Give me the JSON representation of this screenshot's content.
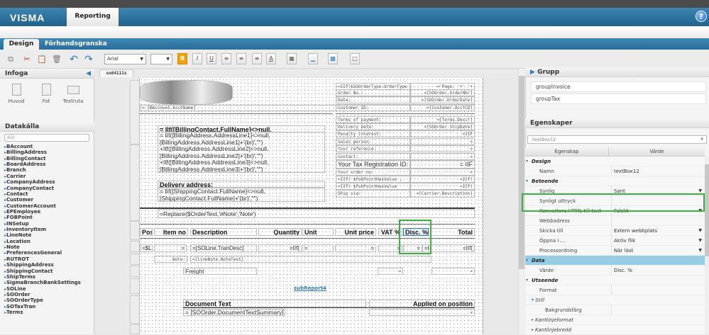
{
  "app": {
    "logo": "VISMA",
    "module_tab": "Reporting",
    "help_icon": "help-icon"
  },
  "tabs": [
    {
      "label": "Design",
      "active": true
    },
    {
      "label": "Förhandsgranska",
      "active": false
    }
  ],
  "toolbar": {
    "font": "Arial",
    "font_size": "",
    "bold": "B",
    "italic": "I",
    "underline": "U",
    "font_color": "A",
    "bold_active_color": "#f0a30a"
  },
  "left": {
    "insert_title": "Infoga",
    "insert_items": [
      "Huvud",
      "Fot",
      "Textruta"
    ],
    "datasource_title": "Datakälla",
    "search_placeholder": "Sök",
    "tree": [
      "BAccount",
      "BillingAddress",
      "BillingContact",
      "BoardAddress",
      "Branch",
      "Carrier",
      "CompanyAddress",
      "CompanyContact",
      "Contact",
      "Customer",
      "CustomerAccount",
      "EPEmployee",
      "FOBPoint",
      "INSetup",
      "InventoryItem",
      "LineNote",
      "Location",
      "Note",
      "PreferencesGeneral",
      "RUTROT",
      "ShippingAddress",
      "ShippingContact",
      "ShipTerms",
      "SigmaBranchBankSettings",
      "SOLine",
      "SOOrder",
      "SOOrderType",
      "SOTaxTran",
      "Terms"
    ]
  },
  "document_tab": "so64111s",
  "report": {
    "acct_name": "= [BAccount.AcctName]",
    "billing_title": "= IIf([BillingContact.FullName]<>null,",
    "billing_lines": [
      "= IIf([BillingAddress.AddressLine1]<>null,",
      "[BillingAddress.AddressLine1]+'{br}',\"\")",
      "+IIf([BillingAddress.AddressLine2]<>null,",
      "[BillingAddress.AddressLine2]+'{br}',\"\")",
      "+IIf([BillingAddress.AddressLine3]<>null,",
      "[BillingAddress.AddressLine3]+'{br}',\"\")"
    ],
    "delivery_title": "Delivery address:",
    "delivery_lines": [
      "= IIf([ShippingContact.FullName]<>null,",
      "[ShippingContact.FullName]+'{br}',\"\")"
    ],
    "info_rows": [
      {
        "label": "=IIf($SOOrderType.OrderType",
        "value": "='Page: '+' '+"
      },
      {
        "label": "Order No.:",
        "value": "=[SOOrder.OrderNbr]"
      },
      {
        "label": "Date:",
        "value": "=[SOOrder.OrderDate]"
      },
      {
        "label": "Customer ID:",
        "value": "=[Customer.AcctCD]"
      },
      {
        "label": "Terms of payment:",
        "value": "=[Terms.Descr]"
      },
      {
        "label": "Delivery Date:",
        "value": "=[SOOrder.ShipDate]"
      },
      {
        "label": "Penalty interest:",
        "value": "=IIF"
      },
      {
        "label": "Sales person:",
        "value": "="
      },
      {
        "label": "Your reference:",
        "value": "="
      },
      {
        "label": "Contact:",
        "value": "="
      },
      {
        "label": "Your Tax Registration ID:",
        "value": "= IIF",
        "large": true
      },
      {
        "label": "Your order no:",
        "value": "="
      },
      {
        "label": "=IIf( $FobPointHasValue ,",
        "value": "=IIf("
      },
      {
        "label": "=IIf( $FobPointHasValue",
        "value": "=IIf("
      },
      {
        "label": "Ship via:",
        "value": "=[Carrier.Description]"
      }
    ],
    "order_text": "=Replace($OrderText,'#Note','Note')",
    "columns": [
      "Pos",
      "Item no",
      "Description",
      "Quantity",
      "Unit",
      "Unit price",
      "VAT %",
      "Disc. %",
      "Total"
    ],
    "detail": [
      "=$Li",
      "=",
      "=[SOLine.TranDesc]",
      "=IIf(",
      "=",
      "=",
      "=",
      "=",
      "=I",
      "=IIf("
    ],
    "note_label": "Note:",
    "note_value": "=[LineNote.NoteText]",
    "freight_label": "Freight",
    "freight_values": [
      "=",
      "="
    ],
    "subreport": "subReport4",
    "doc_text_header": "Document Text",
    "applied_header": "Applied on position",
    "doc_text_value": "= [SOOrder.DocumentTextSummary]",
    "applied_value": "="
  },
  "right": {
    "group_title": "Grupp",
    "groups": [
      "groupInvoice",
      "groupTax"
    ],
    "properties_title": "Egenskaper",
    "selected_object": "textBox12",
    "col_property": "Egenskap",
    "col_value": "Värde",
    "rows": [
      {
        "type": "cat",
        "label": "Design"
      },
      {
        "label": "Namn",
        "value": "textBox12"
      },
      {
        "type": "cat",
        "label": "Beteende"
      },
      {
        "label": "Synlig",
        "value": "Sant",
        "dropdown": true
      },
      {
        "label": "Synligt uttryck",
        "value": ""
      },
      {
        "label": "Konvertera HTML till text",
        "value": "Falskt",
        "dropdown": true
      },
      {
        "label": "Webbadress",
        "value": ""
      },
      {
        "label": "Skicka till",
        "value": "Extern webbplats",
        "dropdown": true
      },
      {
        "label": "Öppna i ...",
        "value": "Aktiv flik",
        "dropdown": true
      },
      {
        "label": "Processordning",
        "value": "När läst",
        "dropdown": true
      },
      {
        "type": "cat",
        "label": "Data",
        "highlight": true
      },
      {
        "label": "Värde",
        "value": "Disc. %"
      },
      {
        "type": "cat",
        "label": "Utseende"
      },
      {
        "label": "Format",
        "value": ""
      },
      {
        "type": "sub",
        "label": "Still"
      },
      {
        "type": "sub2",
        "label": "Bakgrundsfärg",
        "value": ""
      },
      {
        "type": "sub",
        "label": "Kantlinjeformat",
        "collapsed": true
      },
      {
        "type": "sub",
        "label": "Kantlinjebredd",
        "collapsed": true
      }
    ]
  },
  "highlight_color": "#3cb043",
  "accent_color": "#2a6d99"
}
